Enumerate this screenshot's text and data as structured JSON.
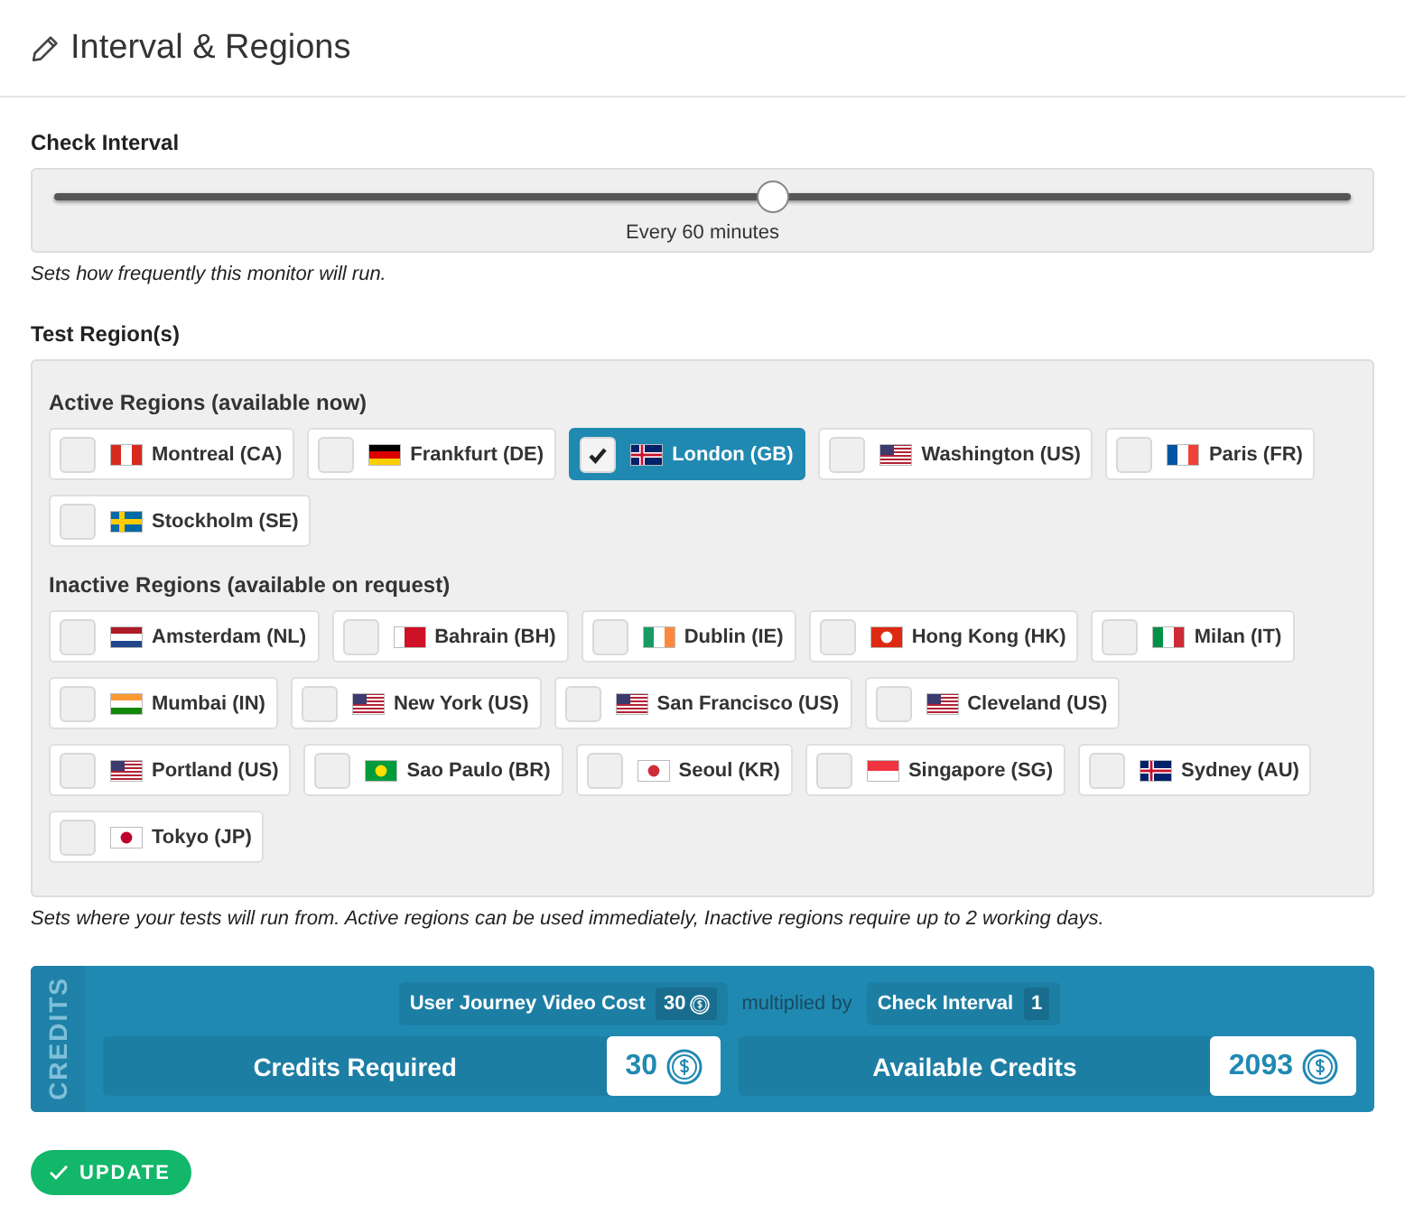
{
  "header": {
    "title": "Interval & Regions"
  },
  "check_interval": {
    "label": "Check Interval",
    "slider": {
      "level": 0.555,
      "reading": "Every 60 minutes"
    },
    "help": "Sets how frequently this monitor will run."
  },
  "test_regions": {
    "label": "Test Region(s)",
    "groups": [
      {
        "title": "Active Regions (available now)",
        "regions": [
          {
            "name": "Montreal (CA)",
            "selected": false
          },
          {
            "name": "Frankfurt (DE)",
            "selected": false
          },
          {
            "name": "London (GB)",
            "selected": true
          },
          {
            "name": "Washington (US)",
            "selected": false
          },
          {
            "name": "Paris (FR)",
            "selected": false
          },
          {
            "name": "Stockholm (SE)",
            "selected": false
          }
        ]
      },
      {
        "title": "Inactive Regions (available on request)",
        "regions": [
          {
            "name": "Amsterdam (NL)",
            "selected": false
          },
          {
            "name": "Bahrain (BH)",
            "selected": false
          },
          {
            "name": "Dublin (IE)",
            "selected": false
          },
          {
            "name": "Hong Kong (HK)",
            "selected": false
          },
          {
            "name": "Milan (IT)",
            "selected": false
          },
          {
            "name": "Mumbai (IN)",
            "selected": false
          },
          {
            "name": "New York (US)",
            "selected": false
          },
          {
            "name": "San Francisco (US)",
            "selected": false
          },
          {
            "name": "Cleveland (US)",
            "selected": false
          },
          {
            "name": "Portland (US)",
            "selected": false
          },
          {
            "name": "Sao Paulo (BR)",
            "selected": false
          },
          {
            "name": "Seoul (KR)",
            "selected": false
          },
          {
            "name": "Singapore (SG)",
            "selected": false
          },
          {
            "name": "Sydney (AU)",
            "selected": false
          },
          {
            "name": "Tokyo (JP)",
            "selected": false
          }
        ]
      }
    ],
    "help": "Sets where your tests will run from. Active regions can be used immediately, Inactive regions require up to 2 working days."
  },
  "credits": {
    "side_label": "CREDITS",
    "cost_label": "User Journey Video Cost",
    "cost_value": "30",
    "multiplier_text": "multiplied by",
    "interval_label": "Check Interval",
    "interval_value": "1",
    "required_label": "Credits Required",
    "required_value": "30",
    "available_label": "Available Credits",
    "available_value": "2093"
  },
  "update_button": {
    "label": "UPDATE"
  }
}
